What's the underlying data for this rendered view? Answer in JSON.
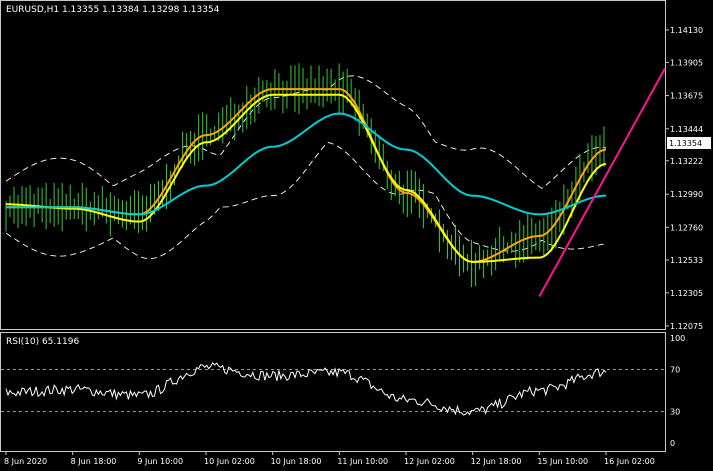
{
  "main_panel": {
    "header": "EURUSD,H1  1.13355 1.13384 1.13298 1.13354",
    "price_axis": [
      "1.14130",
      "1.13905",
      "1.13675",
      "1.13444",
      "1.13222",
      "1.12990",
      "1.12760",
      "1.12533",
      "1.12305",
      "1.12075"
    ],
    "current_price": "1.13354"
  },
  "rsi_panel": {
    "header": "RSI(10) 65.1196",
    "levels": [
      "100",
      "70",
      "30",
      "0"
    ]
  },
  "time_axis": [
    "8 Jun 2020",
    "8 Jun 18:00",
    "9 Jun 10:00",
    "10 Jun 02:00",
    "10 Jun 18:00",
    "11 Jun 10:00",
    "12 Jun 02:00",
    "12 Jun 18:00",
    "15 Jun 10:00",
    "16 Jun 02:00"
  ],
  "colors": {
    "background": "#000000",
    "candles": "#32cd32",
    "ema_fast": "#ffa500",
    "ema_slow": "#ffff00",
    "ma_long": "#00ced1",
    "bands": "#ffffff",
    "trendline": "#ff1493",
    "rsi_line": "#ffffff"
  },
  "chart_data": {
    "type": "line",
    "symbol": "EURUSD",
    "timeframe": "H1",
    "ohlc_last": {
      "open": 1.13355,
      "high": 1.13384,
      "low": 1.13298,
      "close": 1.13354
    },
    "x": [
      "8 Jun 2020",
      "8 Jun 18:00",
      "9 Jun 10:00",
      "10 Jun 02:00",
      "10 Jun 18:00",
      "11 Jun 10:00",
      "12 Jun 02:00",
      "12 Jun 18:00",
      "15 Jun 10:00",
      "16 Jun 02:00"
    ],
    "ylim": [
      1.12075,
      1.1413
    ],
    "series": [
      {
        "values": [
          1.129,
          1.129,
          1.1285,
          1.134,
          1.1372,
          1.1372,
          1.13,
          1.1252,
          1.127,
          1.133
        ]
      },
      {
        "values": [
          1.1292,
          1.1289,
          1.128,
          1.1335,
          1.1368,
          1.1368,
          1.1302,
          1.1252,
          1.1255,
          1.132
        ]
      },
      {
        "values": [
          1.129,
          1.129,
          1.1285,
          1.1305,
          1.1332,
          1.1355,
          1.133,
          1.1298,
          1.1285,
          1.1298
        ]
      }
    ],
    "trendline": {
      "from": [
        "15 Jun 10:00",
        1.1228
      ],
      "to": [
        "16 Jun 02:00",
        1.1312
      ]
    },
    "rsi": {
      "period": 10,
      "last": 65.1196,
      "ylim": [
        0,
        100
      ],
      "levels": [
        70,
        30
      ],
      "values": [
        48,
        51,
        45,
        72,
        64,
        67,
        41,
        30,
        50,
        68
      ]
    }
  }
}
